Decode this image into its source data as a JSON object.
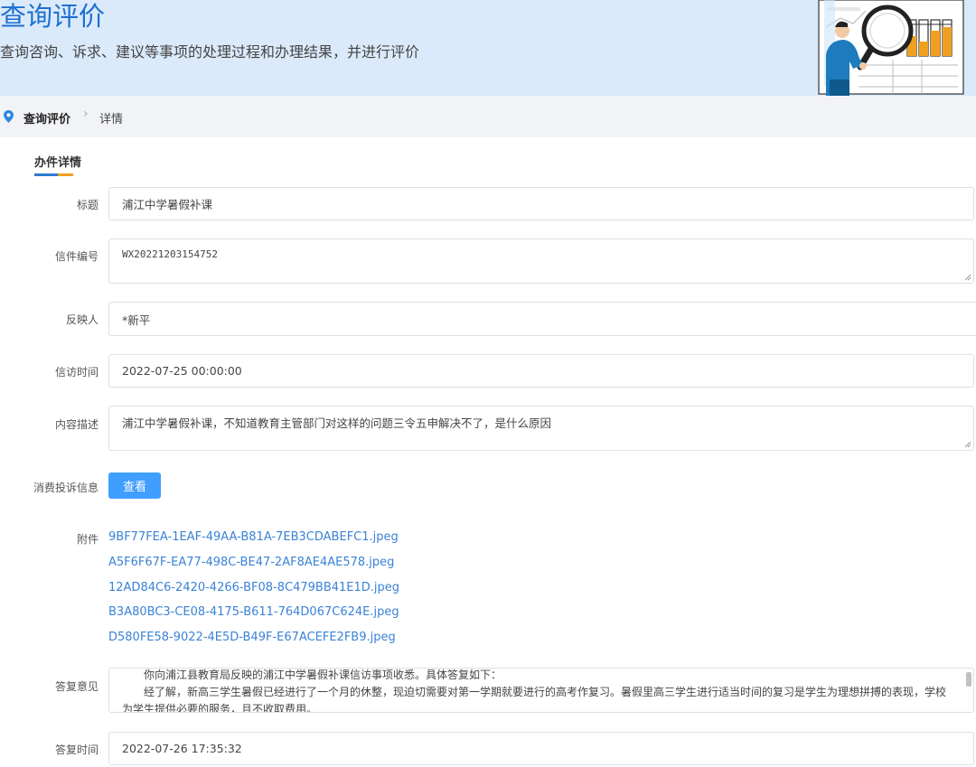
{
  "banner": {
    "title": "查询评价",
    "subtitle": "查询咨询、诉求、建议等事项的处理过程和办理结果，并进行评价"
  },
  "breadcrumb": {
    "items": [
      "查询评价",
      "详情"
    ],
    "separator": "›"
  },
  "section": {
    "title": "办件详情"
  },
  "form": {
    "title": {
      "label": "标题",
      "value": "浦江中学暑假补课"
    },
    "letter_no": {
      "label": "信件编号",
      "value": "WX20221203154752"
    },
    "reporter": {
      "label": "反映人",
      "value": "*新平"
    },
    "visit_time": {
      "label": "信访时间",
      "value": "2022-07-25 00:00:00"
    },
    "content": {
      "label": "内容描述",
      "value": "浦江中学暑假补课，不知道教育主管部门对这样的问题三令五申解决不了，是什么原因"
    },
    "complaint": {
      "label": "消费投诉信息",
      "button": "查看"
    },
    "attachments": {
      "label": "附件",
      "files": [
        "9BF77FEA-1EAF-49AA-B81A-7EB3CDABEFC1.jpeg",
        "A5F6F67F-EA77-498C-BE47-2AF8AE4AE578.jpeg",
        "12AD84C6-2420-4266-BF08-8C479BB41E1D.jpeg",
        "B3A80BC3-CE08-4175-B611-764D067C624E.jpeg",
        "D580FE58-9022-4E5D-B49F-E67ACEFE2FB9.jpeg"
      ]
    },
    "reply": {
      "label": "答复意见",
      "lines": [
        "你向浦江县教育局反映的浦江中学暑假补课信访事项收悉。具体答复如下：",
        "经了解，新高三学生暑假已经进行了一个月的休整，现迫切需要对第一学期就要进行的高考作复习。暑假里高三学生进行适当时间的复习是学生为理想拼搏的表现，学校为学生提供必要的服务，且不收取费用。"
      ]
    },
    "reply_time": {
      "label": "答复时间",
      "value": "2022-07-26 17:35:32"
    }
  },
  "colors": {
    "banner_bg": "#daeafa",
    "title_blue": "#1e6fd0",
    "button_blue": "#409eff",
    "link_blue": "#3b82d6",
    "chart_orange": "#f0a020"
  },
  "icons": [
    "location-pin-icon",
    "chevron-right-icon",
    "magnifier-illustration",
    "bar-chart-illustration"
  ]
}
